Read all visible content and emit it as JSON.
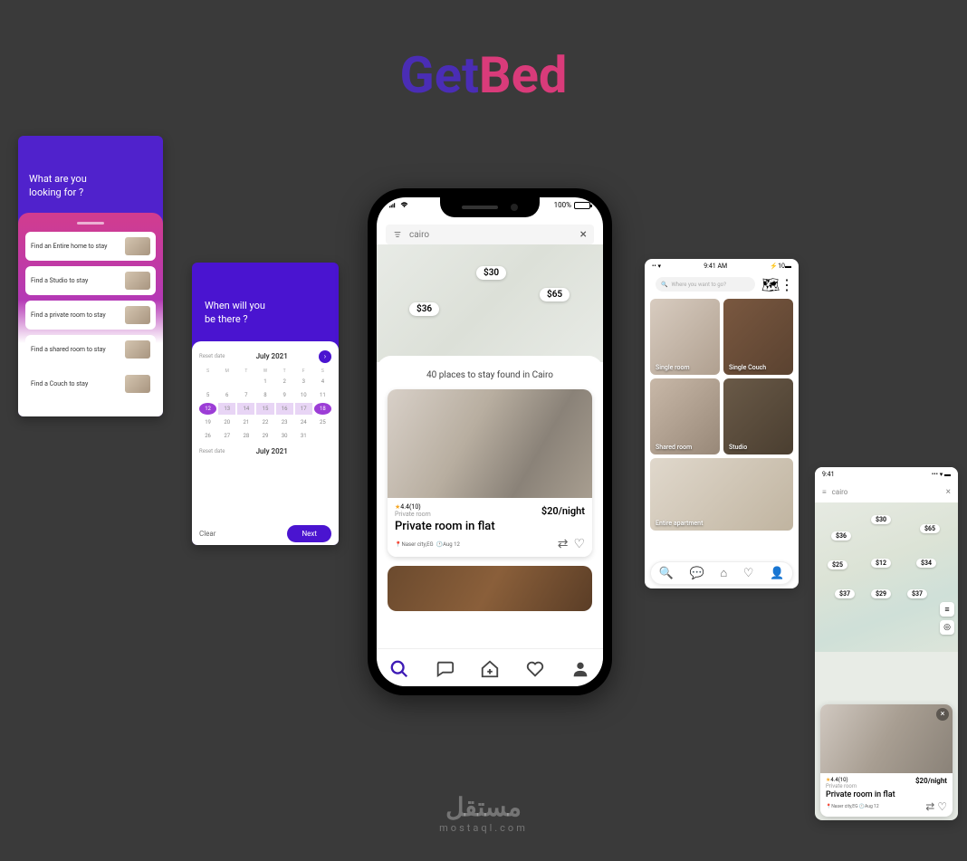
{
  "brand": {
    "part1": "Get",
    "part2": "Bed"
  },
  "watermark": {
    "main": "مستقل",
    "sub": "mostaql.com"
  },
  "screen1": {
    "heading": "What are you\nlooking for ?",
    "options": [
      "Find an Entire home to stay",
      "Find a Studio to stay",
      "Find a private room to stay",
      "Find a shared room to stay",
      "Find a Couch to stay"
    ]
  },
  "screen2": {
    "heading": "When will you\nbe there ?",
    "reset": "Reset date",
    "month1": "July 2021",
    "month2": "July 2021",
    "clear": "Clear",
    "next": "Next",
    "dows": [
      "S",
      "M",
      "T",
      "W",
      "T",
      "F",
      "S"
    ],
    "sel_start": "12",
    "sel_end": "18"
  },
  "phone": {
    "battery": "100%",
    "search_value": "cairo",
    "map_pins": [
      "$30",
      "$36",
      "$65"
    ],
    "count_label": "40 places to stay found in Cairo",
    "card": {
      "rating": "4.4(10)",
      "type": "Private room",
      "price": "$20/night",
      "title": "Private room in flat",
      "location": "Naser city,EG",
      "date": "Aug 12"
    }
  },
  "screen4": {
    "time": "9:41 AM",
    "battery_pct": "10",
    "search_placeholder": "Where you want to go?",
    "cells": [
      "Single room",
      "Single Couch",
      "Shared room",
      "Studio",
      "Entire apartment"
    ]
  },
  "screen5": {
    "time": "9:41",
    "search_value": "cairo",
    "pins": [
      "$30",
      "$36",
      "$65",
      "$25",
      "$12",
      "$34",
      "$37",
      "$29",
      "$37"
    ],
    "card": {
      "rating": "4.4(10)",
      "type": "Private room",
      "price": "$20/night",
      "title": "Private room in flat",
      "location": "Naser city,EG",
      "date": "Aug 12"
    }
  }
}
